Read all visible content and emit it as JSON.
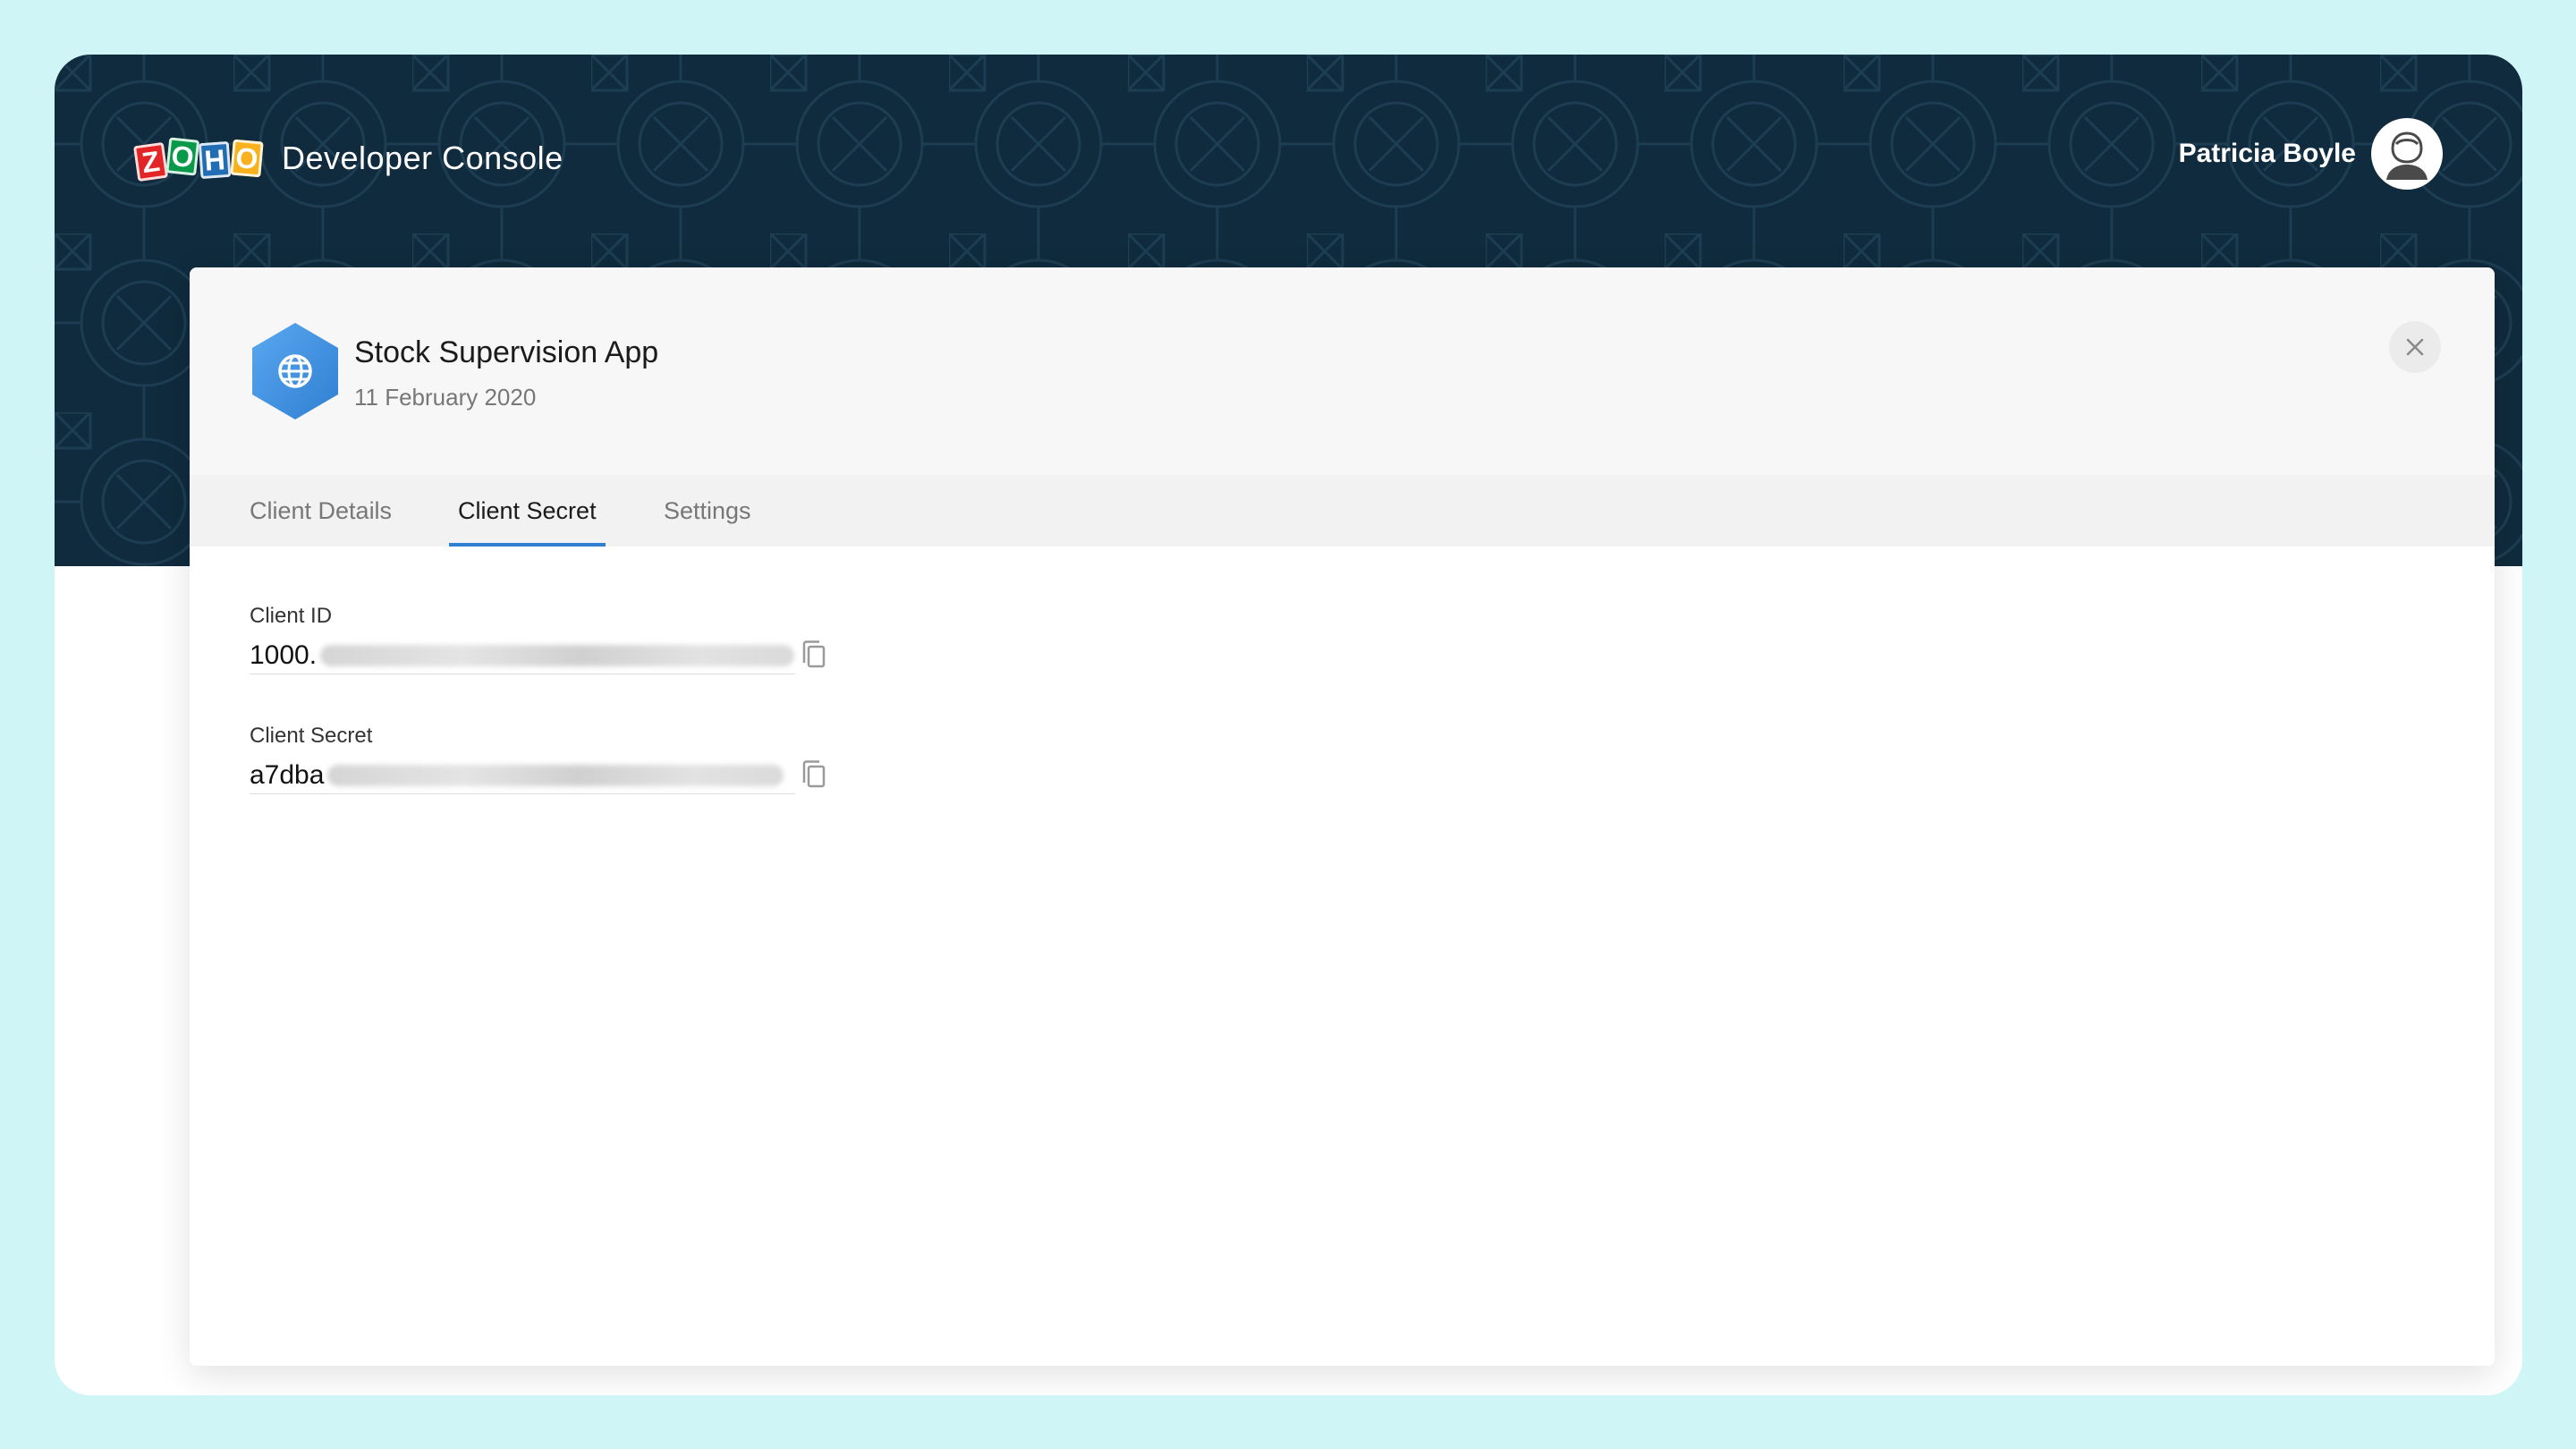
{
  "header": {
    "logo_letters": [
      "Z",
      "O",
      "H",
      "O"
    ],
    "console_title": "Developer Console",
    "user_name": "Patricia Boyle",
    "avatar_icon": "user-avatar-icon"
  },
  "app": {
    "name": "Stock Supervision App",
    "date": "11 February 2020",
    "icon": "globe-icon",
    "icon_color": "#3a8ee6"
  },
  "tabs": [
    {
      "label": "Client Details",
      "active": false
    },
    {
      "label": "Client Secret",
      "active": true
    },
    {
      "label": "Settings",
      "active": false
    }
  ],
  "fields": {
    "client_id": {
      "label": "Client ID",
      "value_visible": "1000.",
      "copy_icon": "copy-icon"
    },
    "client_secret": {
      "label": "Client Secret",
      "value_visible": "a7dba",
      "copy_icon": "copy-icon"
    }
  },
  "colors": {
    "page_bg": "#d0f5f7",
    "header_bg": "#102b3d",
    "accent": "#2f7fd3"
  }
}
